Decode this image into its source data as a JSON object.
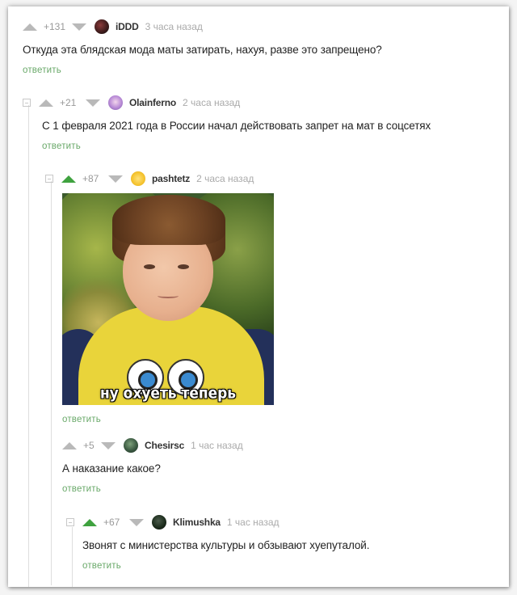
{
  "reply_label": "ответить",
  "colors": {
    "accent": "#3fa23f",
    "link": "#6aa96a"
  },
  "comments": [
    {
      "rating": "+131",
      "username": "iDDD",
      "time": "3 часа назад",
      "text": "Откуда эта блядская мода маты затирать, нахуя, разве это запрещено?",
      "avatar_icon": "dark-avatar-icon"
    },
    {
      "rating": "+21",
      "username": "Olainferno",
      "time": "2 часа назад",
      "text": "С 1 февраля 2021 года в России начал действовать запрет на мат в соцсетях",
      "avatar_icon": "anime-avatar-icon"
    },
    {
      "rating": "+87",
      "username": "pashtetz",
      "time": "2 часа назад",
      "text": "",
      "avatar_icon": "emoji-avatar-icon",
      "image_caption": "ну охуеть теперь"
    },
    {
      "rating": "+5",
      "username": "Chesirsc",
      "time": "1 час назад",
      "text": "А наказание какое?",
      "avatar_icon": "cat-avatar-icon"
    },
    {
      "rating": "+67",
      "username": "Klimushka",
      "time": "1 час назад",
      "text": "Звонят с министерства культуры и обзывают хуепуталой.",
      "avatar_icon": "dark-avatar-icon"
    }
  ]
}
